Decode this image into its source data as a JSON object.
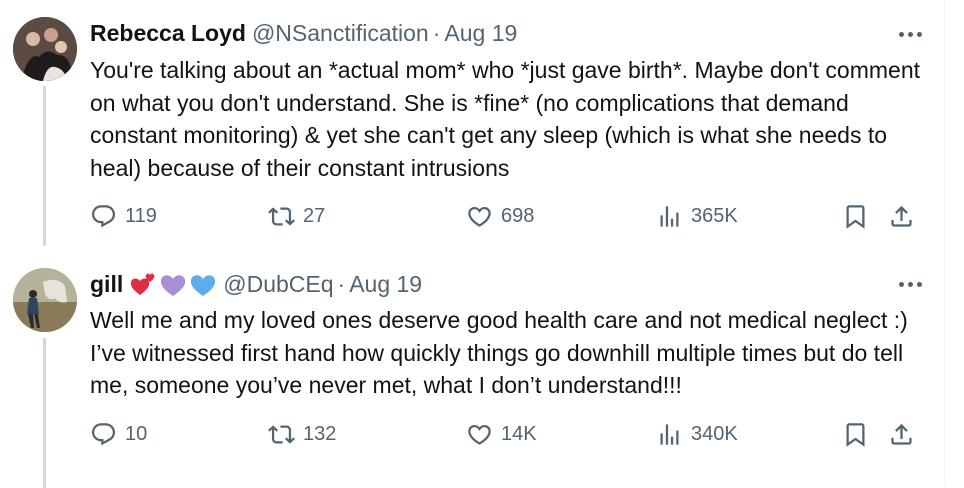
{
  "colors": {
    "text": "#0f1419",
    "secondary": "#536471",
    "thread_line": "#cfd9de"
  },
  "tweets": [
    {
      "name": "Rebecca Loyd",
      "handle": "@NSanctification",
      "dot": "·",
      "date": "Aug 19",
      "emojis": [],
      "text": "You're talking about an *actual mom* who *just gave birth*. Maybe don't comment on what you don't understand. She is *fine* (no complications that demand constant monitoring) & yet she can't get any sleep (which is what she needs to heal) because of their constant intrusions",
      "replies": "119",
      "reposts": "27",
      "likes": "698",
      "views": "365K",
      "icons": {
        "more": "more-icon",
        "reply": "reply-icon",
        "repost": "repost-icon",
        "like": "heart-icon",
        "views": "views-icon",
        "bookmark": "bookmark-icon",
        "share": "share-icon"
      }
    },
    {
      "name": "gill",
      "handle": "@DubCEq",
      "dot": "·",
      "date": "Aug 19",
      "emojis": [
        "revolving-hearts-emoji",
        "purple-heart-emoji",
        "blue-heart-emoji"
      ],
      "text": "Well me and my loved ones deserve good health care and not medical neglect :) I’ve witnessed first hand how quickly things go downhill multiple times but do tell me, someone you’ve never met, what I don’t understand!!!",
      "replies": "10",
      "reposts": "132",
      "likes": "14K",
      "views": "340K",
      "icons": {
        "more": "more-icon",
        "reply": "reply-icon",
        "repost": "repost-icon",
        "like": "heart-icon",
        "views": "views-icon",
        "bookmark": "bookmark-icon",
        "share": "share-icon"
      }
    }
  ]
}
